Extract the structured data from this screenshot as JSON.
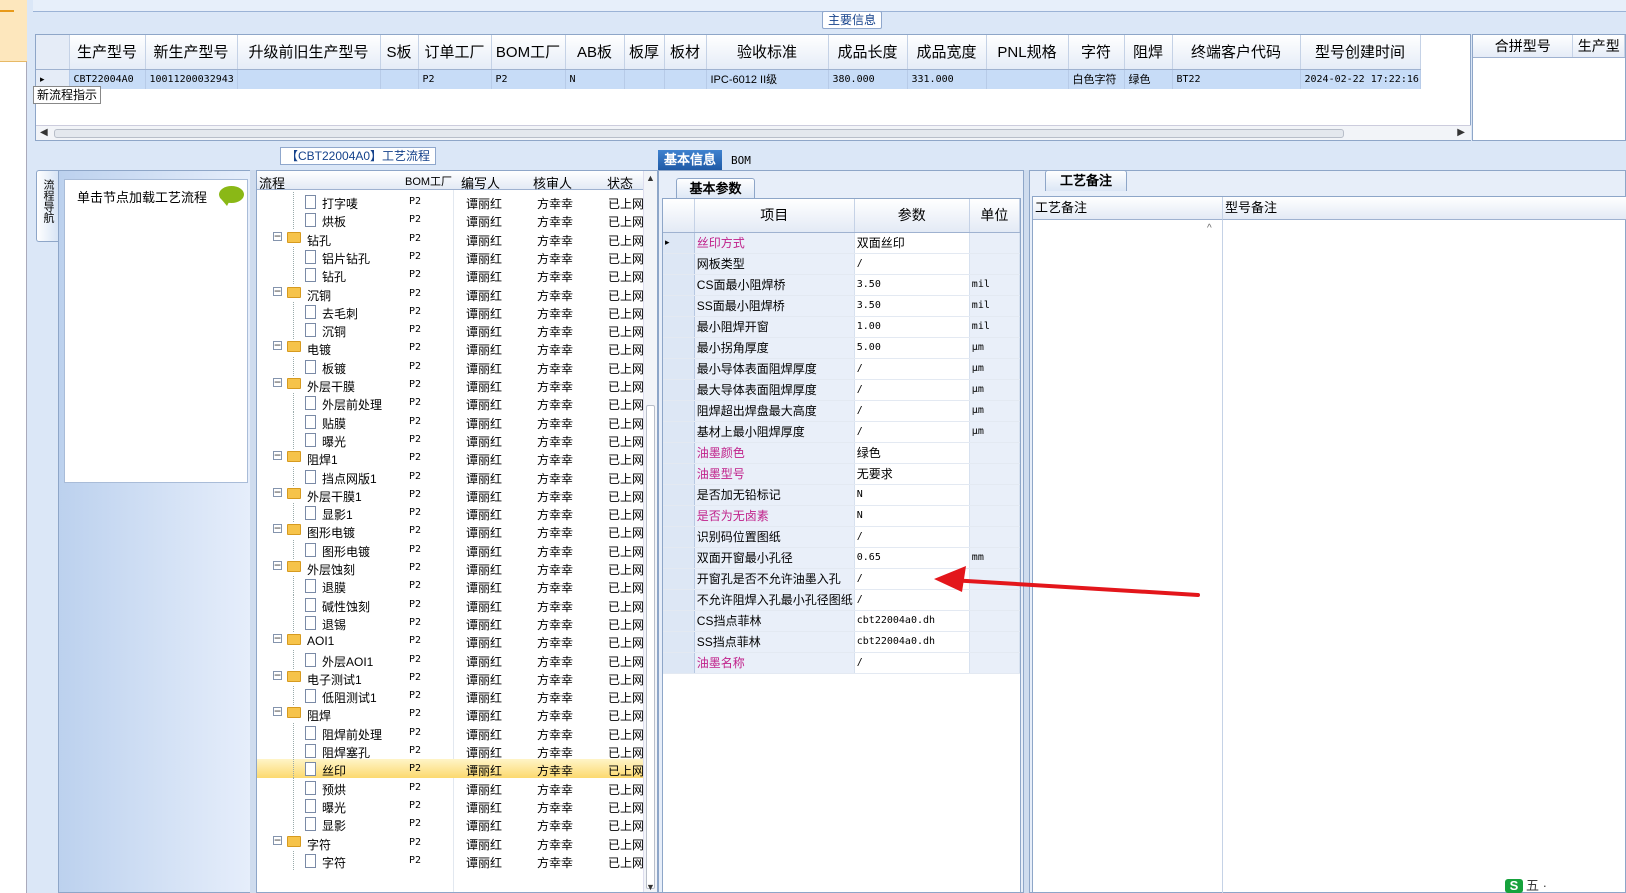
{
  "main_info_label": "主要信息",
  "main_grid": {
    "headers": [
      "生产型号",
      "新生产型号",
      "升级前旧生产型号",
      "S板",
      "订单工厂",
      "BOM工厂",
      "AB板",
      "板厚",
      "板材",
      "验收标准",
      "成品长度",
      "成品宽度",
      "PNL规格",
      "字符",
      "阻焊",
      "终端客户代码",
      "型号创建时间"
    ],
    "row": [
      "CBT22004A0",
      "10011200032943",
      "",
      "",
      "P2",
      "P2",
      "N",
      "",
      "",
      "IPC-6012 II级",
      "380.000",
      "331.000",
      "",
      "白色字符",
      "绿色",
      "BT22",
      "2024-02-22 17:22:16"
    ],
    "tooltip": "新流程指示"
  },
  "merge_grid": {
    "headers": [
      "合拼型号",
      "生产型"
    ]
  },
  "process": {
    "panel_label": "【CBT22004A0】工艺流程",
    "vertical_tab": "流程导航",
    "nav_hint": "单击节点加载工艺流程",
    "headers": [
      "流程",
      "BOM工厂",
      "编写人",
      "核审人",
      "状态"
    ],
    "rows": [
      {
        "name": "打字唛",
        "level": 2,
        "factory": "P2",
        "writer": "谭丽红",
        "reviewer": "方幸幸",
        "status": "已上网"
      },
      {
        "name": "烘板",
        "level": 2,
        "factory": "P2",
        "writer": "谭丽红",
        "reviewer": "方幸幸",
        "status": "已上网"
      },
      {
        "name": "钻孔",
        "level": 1,
        "factory": "P2",
        "writer": "谭丽红",
        "reviewer": "方幸幸",
        "status": "已上网"
      },
      {
        "name": "铝片钻孔",
        "level": 2,
        "factory": "P2",
        "writer": "谭丽红",
        "reviewer": "方幸幸",
        "status": "已上网"
      },
      {
        "name": "钻孔",
        "level": 2,
        "factory": "P2",
        "writer": "谭丽红",
        "reviewer": "方幸幸",
        "status": "已上网"
      },
      {
        "name": "沉铜",
        "level": 1,
        "factory": "P2",
        "writer": "谭丽红",
        "reviewer": "方幸幸",
        "status": "已上网"
      },
      {
        "name": "去毛刺",
        "level": 2,
        "factory": "P2",
        "writer": "谭丽红",
        "reviewer": "方幸幸",
        "status": "已上网"
      },
      {
        "name": "沉铜",
        "level": 2,
        "factory": "P2",
        "writer": "谭丽红",
        "reviewer": "方幸幸",
        "status": "已上网"
      },
      {
        "name": "电镀",
        "level": 1,
        "factory": "P2",
        "writer": "谭丽红",
        "reviewer": "方幸幸",
        "status": "已上网"
      },
      {
        "name": "板镀",
        "level": 2,
        "factory": "P2",
        "writer": "谭丽红",
        "reviewer": "方幸幸",
        "status": "已上网"
      },
      {
        "name": "外层干膜",
        "level": 1,
        "factory": "P2",
        "writer": "谭丽红",
        "reviewer": "方幸幸",
        "status": "已上网"
      },
      {
        "name": "外层前处理",
        "level": 2,
        "factory": "P2",
        "writer": "谭丽红",
        "reviewer": "方幸幸",
        "status": "已上网"
      },
      {
        "name": "贴膜",
        "level": 2,
        "factory": "P2",
        "writer": "谭丽红",
        "reviewer": "方幸幸",
        "status": "已上网"
      },
      {
        "name": "曝光",
        "level": 2,
        "factory": "P2",
        "writer": "谭丽红",
        "reviewer": "方幸幸",
        "status": "已上网"
      },
      {
        "name": "阻焊1",
        "level": 1,
        "factory": "P2",
        "writer": "谭丽红",
        "reviewer": "方幸幸",
        "status": "已上网"
      },
      {
        "name": "挡点网版1",
        "level": 2,
        "factory": "P2",
        "writer": "谭丽红",
        "reviewer": "方幸幸",
        "status": "已上网"
      },
      {
        "name": "外层干膜1",
        "level": 1,
        "factory": "P2",
        "writer": "谭丽红",
        "reviewer": "方幸幸",
        "status": "已上网"
      },
      {
        "name": "显影1",
        "level": 2,
        "factory": "P2",
        "writer": "谭丽红",
        "reviewer": "方幸幸",
        "status": "已上网"
      },
      {
        "name": "图形电镀",
        "level": 1,
        "factory": "P2",
        "writer": "谭丽红",
        "reviewer": "方幸幸",
        "status": "已上网"
      },
      {
        "name": "图形电镀",
        "level": 2,
        "factory": "P2",
        "writer": "谭丽红",
        "reviewer": "方幸幸",
        "status": "已上网"
      },
      {
        "name": "外层蚀刻",
        "level": 1,
        "factory": "P2",
        "writer": "谭丽红",
        "reviewer": "方幸幸",
        "status": "已上网"
      },
      {
        "name": "退膜",
        "level": 2,
        "factory": "P2",
        "writer": "谭丽红",
        "reviewer": "方幸幸",
        "status": "已上网"
      },
      {
        "name": "碱性蚀刻",
        "level": 2,
        "factory": "P2",
        "writer": "谭丽红",
        "reviewer": "方幸幸",
        "status": "已上网"
      },
      {
        "name": "退锡",
        "level": 2,
        "factory": "P2",
        "writer": "谭丽红",
        "reviewer": "方幸幸",
        "status": "已上网"
      },
      {
        "name": "AOI1",
        "level": 1,
        "factory": "P2",
        "writer": "谭丽红",
        "reviewer": "方幸幸",
        "status": "已上网"
      },
      {
        "name": "外层AOI1",
        "level": 2,
        "factory": "P2",
        "writer": "谭丽红",
        "reviewer": "方幸幸",
        "status": "已上网"
      },
      {
        "name": "电子测试1",
        "level": 1,
        "factory": "P2",
        "writer": "谭丽红",
        "reviewer": "方幸幸",
        "status": "已上网"
      },
      {
        "name": "低阻测试1",
        "level": 2,
        "factory": "P2",
        "writer": "谭丽红",
        "reviewer": "方幸幸",
        "status": "已上网"
      },
      {
        "name": "阻焊",
        "level": 1,
        "factory": "P2",
        "writer": "谭丽红",
        "reviewer": "方幸幸",
        "status": "已上网"
      },
      {
        "name": "阻焊前处理",
        "level": 2,
        "factory": "P2",
        "writer": "谭丽红",
        "reviewer": "方幸幸",
        "status": "已上网"
      },
      {
        "name": "阻焊塞孔",
        "level": 2,
        "factory": "P2",
        "writer": "谭丽红",
        "reviewer": "方幸幸",
        "status": "已上网"
      },
      {
        "name": "丝印",
        "level": 2,
        "factory": "P2",
        "writer": "谭丽红",
        "reviewer": "方幸幸",
        "status": "已上网",
        "selected": true
      },
      {
        "name": "预烘",
        "level": 2,
        "factory": "P2",
        "writer": "谭丽红",
        "reviewer": "方幸幸",
        "status": "已上网"
      },
      {
        "name": "曝光",
        "level": 2,
        "factory": "P2",
        "writer": "谭丽红",
        "reviewer": "方幸幸",
        "status": "已上网"
      },
      {
        "name": "显影",
        "level": 2,
        "factory": "P2",
        "writer": "谭丽红",
        "reviewer": "方幸幸",
        "status": "已上网"
      },
      {
        "name": "字符",
        "level": 1,
        "factory": "P2",
        "writer": "谭丽红",
        "reviewer": "方幸幸",
        "status": "已上网"
      },
      {
        "name": "字符",
        "level": 2,
        "factory": "P2",
        "writer": "谭丽红",
        "reviewer": "方幸幸",
        "status": "已上网"
      }
    ]
  },
  "tabs": {
    "basic": "基本信息",
    "bom": "BOM"
  },
  "basic_params": {
    "subtab": "基本参数",
    "headers": [
      "项目",
      "参数",
      "单位"
    ],
    "rows": [
      {
        "item": "丝印方式",
        "value": "双面丝印",
        "unit": "",
        "hl": true
      },
      {
        "item": "网板类型",
        "value": "/",
        "unit": ""
      },
      {
        "item": "CS面最小阻焊桥",
        "value": "3.50",
        "unit": "mil"
      },
      {
        "item": "SS面最小阻焊桥",
        "value": "3.50",
        "unit": "mil"
      },
      {
        "item": "最小阻焊开窗",
        "value": "1.00",
        "unit": "mil"
      },
      {
        "item": "最小拐角厚度",
        "value": "5.00",
        "unit": "μm"
      },
      {
        "item": "最小导体表面阻焊厚度",
        "value": "/",
        "unit": "μm"
      },
      {
        "item": "最大导体表面阻焊厚度",
        "value": "/",
        "unit": "μm"
      },
      {
        "item": "阻焊超出焊盘最大高度",
        "value": "/",
        "unit": "μm"
      },
      {
        "item": "基材上最小阻焊厚度",
        "value": "/",
        "unit": "μm"
      },
      {
        "item": "油墨颜色",
        "value": "绿色",
        "unit": "",
        "hl": true
      },
      {
        "item": "油墨型号",
        "value": "无要求",
        "unit": "",
        "hl": true
      },
      {
        "item": "是否加无铅标记",
        "value": "N",
        "unit": ""
      },
      {
        "item": "是否为无卤素",
        "value": "N",
        "unit": "",
        "hl": true
      },
      {
        "item": "识别码位置图纸",
        "value": "/",
        "unit": ""
      },
      {
        "item": "双面开窗最小孔径",
        "value": "0.65",
        "unit": "mm"
      },
      {
        "item": "开窗孔是否不允许油墨入孔",
        "value": "/",
        "unit": ""
      },
      {
        "item": "不允许阻焊入孔最小孔径图纸",
        "value": "/",
        "unit": ""
      },
      {
        "item": "CS挡点菲林",
        "value": "cbt22004a0.dh",
        "unit": ""
      },
      {
        "item": "SS挡点菲林",
        "value": "cbt22004a0.dh",
        "unit": ""
      },
      {
        "item": "油墨名称",
        "value": "/",
        "unit": "",
        "hl": true
      }
    ]
  },
  "notes": {
    "tab": "工艺备注",
    "col1": "工艺备注",
    "col2": "型号备注"
  },
  "logo_text": "五 ·",
  "colors": {
    "arrow": "#e3161b",
    "selected_row": "#fcd96f",
    "highlight_text": "#c0208a"
  }
}
